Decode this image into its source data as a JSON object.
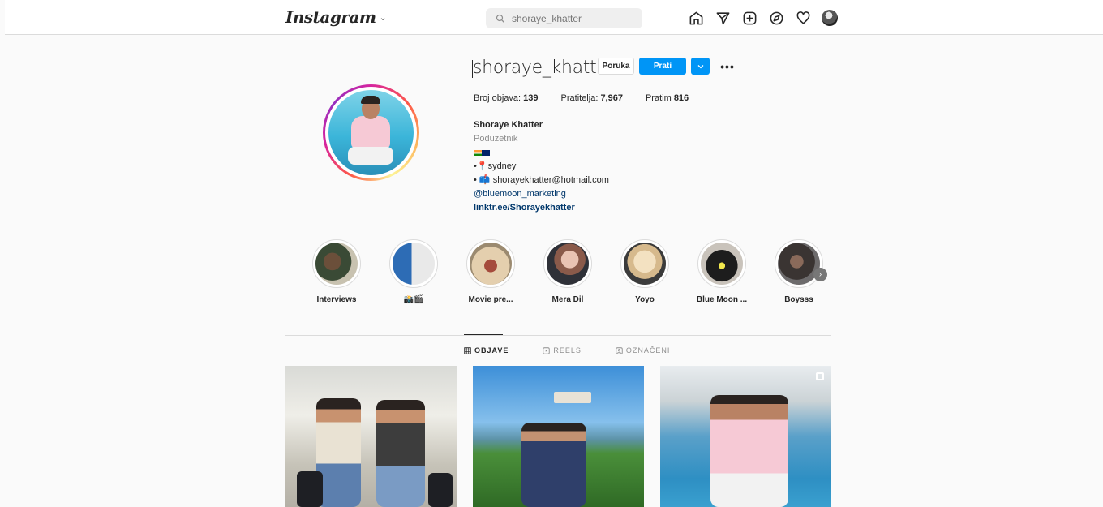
{
  "header": {
    "logo": "Instagram",
    "search_placeholder": "shoraye_khatter"
  },
  "profile": {
    "username": "shoraye_khatter",
    "message_label": "Poruka",
    "follow_label": "Prati",
    "stats": {
      "posts_label": "Broj objava:",
      "posts": "139",
      "followers_label": "Pratitelja:",
      "followers": "7,967",
      "following_label": "Pratim",
      "following": "816"
    },
    "bio": {
      "name": "Shoraye Khatter",
      "category": "Poduzetnik",
      "location": "sydney",
      "email": "shorayekhatter@hotmail.com",
      "mention": "@bluemoon_marketing",
      "link": "linktr.ee/Shorayekhatter"
    }
  },
  "highlights": [
    {
      "label": "Interviews"
    },
    {
      "label": "📸🎬"
    },
    {
      "label": "Movie pre..."
    },
    {
      "label": "Mera Dil"
    },
    {
      "label": "Yoyo"
    },
    {
      "label": "Blue Moon ..."
    },
    {
      "label": "Boysss"
    }
  ],
  "tabs": [
    {
      "label": "OBJAVE"
    },
    {
      "label": "REELS"
    },
    {
      "label": "OZNAČENI"
    }
  ],
  "colors": {
    "accent": "#0095f6",
    "link": "#00376b"
  }
}
